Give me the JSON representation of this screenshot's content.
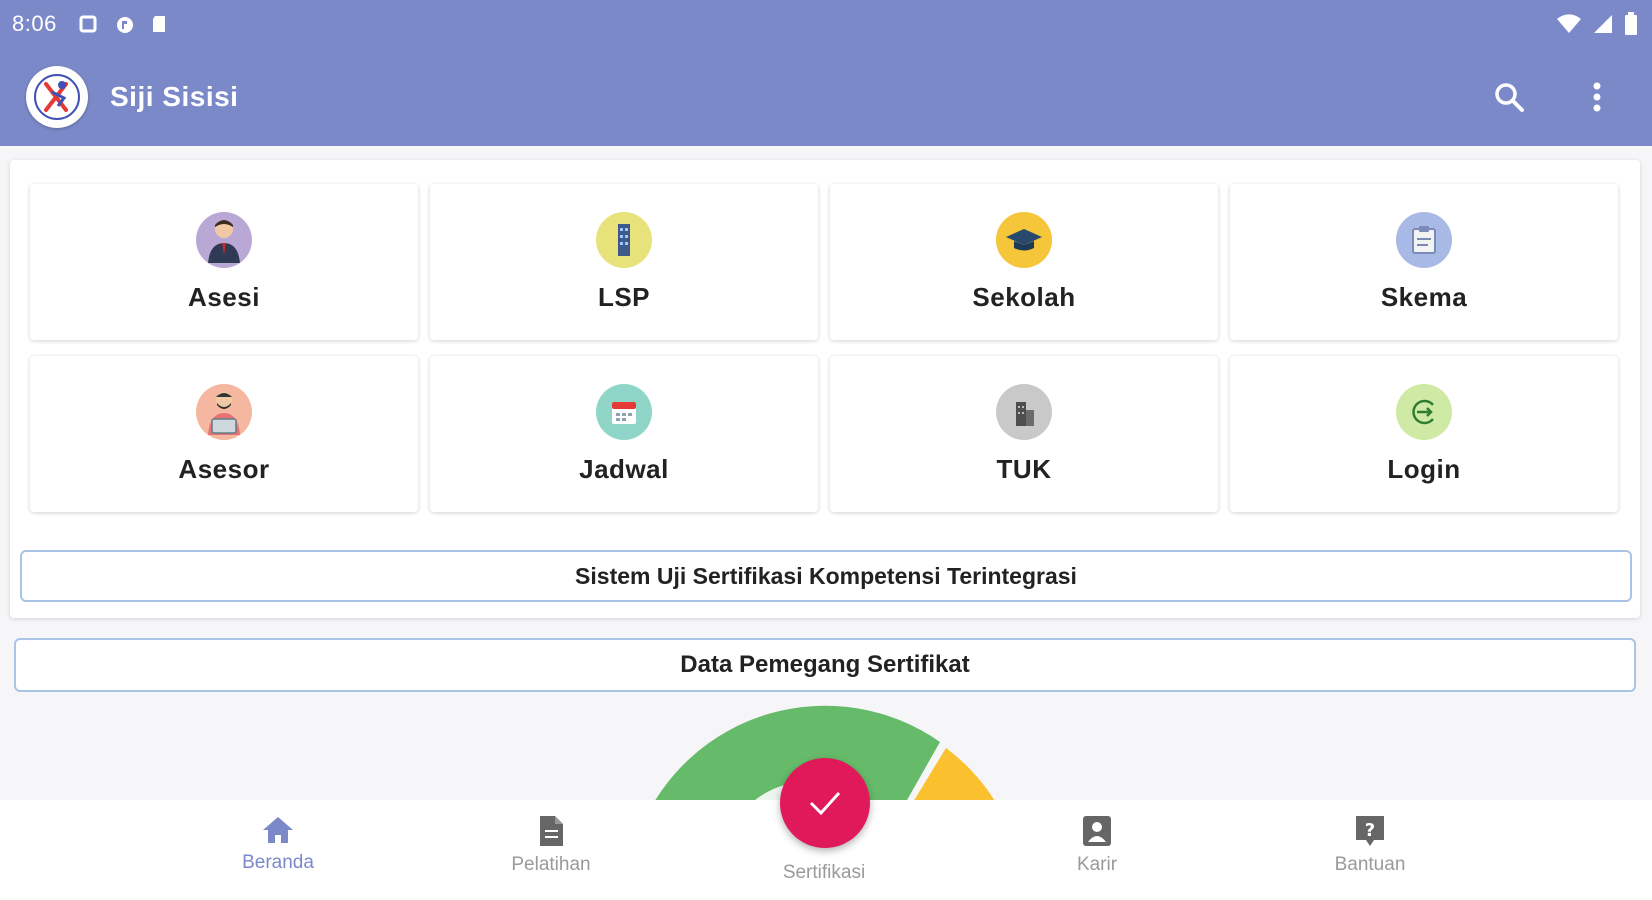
{
  "status_bar": {
    "time": "8:06"
  },
  "app_bar": {
    "title": "Siji Sisisi"
  },
  "grid": [
    {
      "label": "Asesi",
      "icon": "user-suit-icon",
      "color": "#b9a7d6"
    },
    {
      "label": "LSP",
      "icon": "building-icon",
      "color": "#e8e27a"
    },
    {
      "label": "Sekolah",
      "icon": "graduation-cap-icon",
      "color": "#f5c53a"
    },
    {
      "label": "Skema",
      "icon": "document-board-icon",
      "color": "#a9b9e6"
    },
    {
      "label": "Asesor",
      "icon": "assessor-laptop-icon",
      "color": "#f5b79f"
    },
    {
      "label": "Jadwal",
      "icon": "calendar-icon",
      "color": "#8fd6c8"
    },
    {
      "label": "TUK",
      "icon": "office-building-icon",
      "color": "#c9c9c9"
    },
    {
      "label": "Login",
      "icon": "login-arrow-icon",
      "color": "#cfeaa4"
    }
  ],
  "buttons": {
    "sistem": "Sistem Uji Sertifikasi Kompetensi Terintegrasi",
    "data": "Data Pemegang Sertifikat"
  },
  "bottom_nav": [
    {
      "label": "Beranda",
      "icon": "home-icon",
      "active": true
    },
    {
      "label": "Pelatihan",
      "icon": "document-icon",
      "active": false
    },
    {
      "label": "Sertifikasi",
      "icon": "check-icon",
      "active": false
    },
    {
      "label": "Karir",
      "icon": "person-badge-icon",
      "active": false
    },
    {
      "label": "Bantuan",
      "icon": "help-icon",
      "active": false
    }
  ],
  "colors": {
    "primary": "#7b89c9",
    "fab": "#e0195a",
    "gauge_green": "#66bb6a",
    "gauge_yellow": "#fbc02d"
  }
}
